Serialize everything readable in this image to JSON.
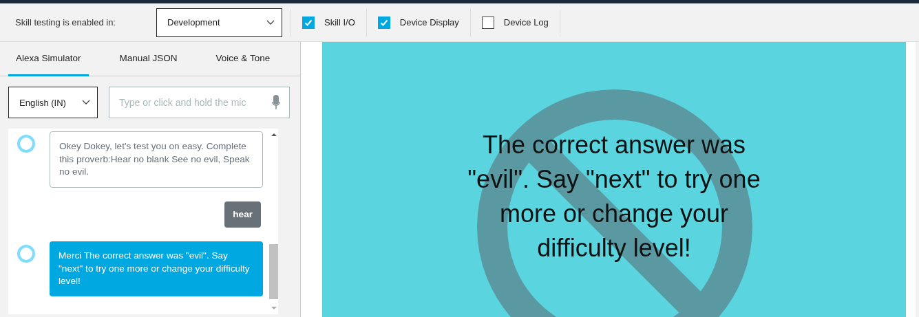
{
  "toolbar": {
    "label": "Skill testing is enabled in:",
    "stage": "Development",
    "options": [
      {
        "label": "Skill I/O",
        "checked": true
      },
      {
        "label": "Device Display",
        "checked": true
      },
      {
        "label": "Device Log",
        "checked": false
      }
    ]
  },
  "tabs": [
    {
      "label": "Alexa Simulator",
      "selected": true
    },
    {
      "label": "Manual JSON",
      "selected": false
    },
    {
      "label": "Voice & Tone",
      "selected": false
    }
  ],
  "locale": "English (IN)",
  "utterance": {
    "placeholder": "Type or click and hold the mic"
  },
  "messages": [
    {
      "kind": "alexa",
      "text": "Okey Dokey, let's test you on easy. Complete this proverb:Hear no blank See no evil, Speak no evil.",
      "selected": false
    },
    {
      "kind": "user",
      "text": "hear",
      "selected": false
    },
    {
      "kind": "alexa",
      "text": "Merci The correct answer was \"evil\". Say \"next\" to try one more or change your difficulty level!",
      "selected": true
    }
  ],
  "display": {
    "text": "The correct answer was \"evil\". Say \"next\" to try one more or change your difficulty level!"
  }
}
